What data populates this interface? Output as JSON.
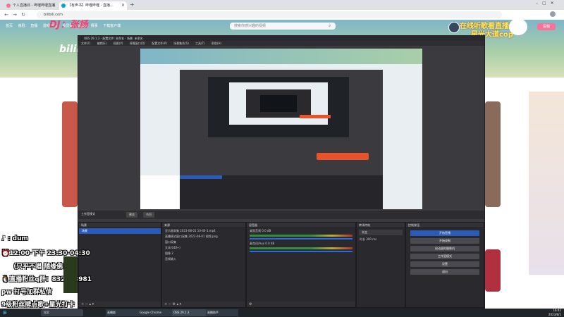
{
  "browser": {
    "tabs": [
      {
        "label": "个人直播间 - 哔哩哔哩直播",
        "active": false
      },
      {
        "label": "【有声书】哔哩哔哩 - 直播...",
        "active": true
      }
    ],
    "new_tab": "+",
    "url": "bilibili.com",
    "back": "←",
    "forward": "→",
    "reload": "↻"
  },
  "bilibili": {
    "nav_items": [
      "首页",
      "番剧",
      "直播",
      "游戏中心",
      "会员购",
      "漫画",
      "赛事",
      "下载客户端"
    ],
    "search_placeholder": "搜索你感兴趣的视频",
    "logo": "bilibili",
    "upload_label": "投稿",
    "banner_text_1": "DJ：张扬",
    "banner_text_2": "在线听歌看直播",
    "banner_text_3": "星光大道cop"
  },
  "obs": {
    "title": "OBS 29.1.3 - 配置文件: 未命名 - 场景: 未命名",
    "menu": [
      "文件(F)",
      "编辑(E)",
      "视图(V)",
      "停靠窗口(D)",
      "配置文件(P)",
      "场景集合(S)",
      "工具(T)",
      "帮助(H)"
    ],
    "studio_mode": "工作室模式",
    "mode_buttons": [
      "预览",
      "节目"
    ],
    "docks": {
      "scenes": {
        "header": "场景",
        "items": [
          "场景"
        ],
        "footer": "+  −  ▴  ▾"
      },
      "sources": {
        "header": "来源",
        "items": [
          "显示器采集 2023-08-01 10-40-1.mp4",
          "直播模式窗口采集 2023-08-01 视频.png",
          "窗口采集",
          "文本(GDI+)",
          "图像 2",
          "音频输入"
        ],
        "footer": "+  −  ⚙  ▴  ▾"
      },
      "mixer": {
        "header": "混音器",
        "channels": [
          "桌面音频",
          "麦克风/Aux"
        ],
        "db": [
          "0.0 dB",
          "0.0 dB"
        ]
      },
      "transitions": {
        "header": "转场特效",
        "transition": "渐变",
        "duration_label": "时长",
        "duration": "300 ms"
      },
      "controls": {
        "header": "控制按钮",
        "buttons": [
          "开始直播",
          "开始录制",
          "启动虚拟摄像机",
          "工作室模式",
          "设置",
          "退出"
        ]
      }
    }
  },
  "overlay": {
    "line1": "dum",
    "line2": "12:00-下午  23:30-04:30",
    "line3": "（只平不唱 随缘佛系）",
    "line4": "直播粉丝q群：832868981",
    "line5": "pw 打号加群私信",
    "line6": "9级粉丝牌点歌+星光打卡"
  },
  "taskbar": {
    "search": "搜索",
    "apps": [
      "直播姬",
      "Google Chrome",
      "OBS 29.1.3",
      "直播助手"
    ],
    "time": "16:42",
    "date": "2023/8/1"
  },
  "colors": {
    "accent_blue": "#2b5bb9",
    "bili_pink": "#fb7299",
    "obs_bg": "#3a3a3f"
  }
}
